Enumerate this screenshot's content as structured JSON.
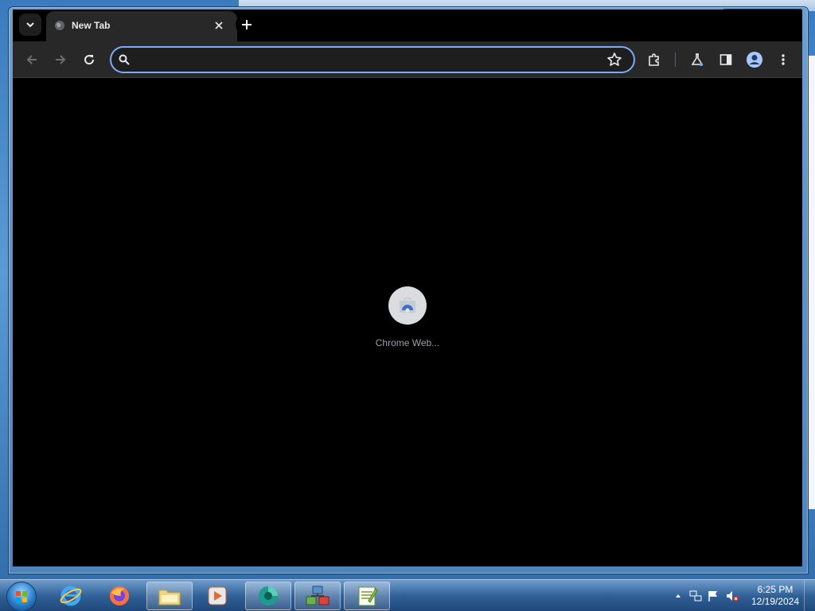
{
  "browser": {
    "tab": {
      "title": "New Tab"
    },
    "omnibox": {
      "value": "",
      "placeholder": ""
    },
    "accent_color": "#7cacf8"
  },
  "new_tab_page": {
    "shortcut": {
      "label": "Chrome Web..."
    }
  },
  "toolbar_icons": [
    "back-icon",
    "forward-icon",
    "reload-icon",
    "star-icon",
    "extensions-icon",
    "labs-icon",
    "side-panel-icon",
    "profile-icon",
    "menu-icon"
  ],
  "taskbar": {
    "apps": [
      "internet-explorer",
      "firefox",
      "file-explorer",
      "media-player",
      "chrome-app",
      "network-tool",
      "notepad-plus"
    ],
    "clock": {
      "time": "6:25 PM",
      "date": "12/19/2024"
    }
  }
}
